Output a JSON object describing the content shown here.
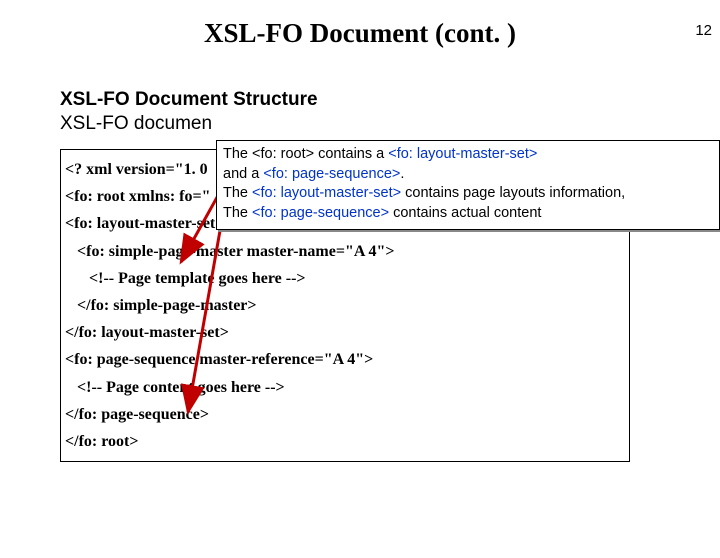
{
  "page_number": "12",
  "title": "XSL-FO Document (cont. )",
  "subhead": "XSL-FO Document Structure",
  "subline": "XSL-FO documen",
  "popup": {
    "l1a": "The <fo: root> contains a ",
    "l1b": "<fo: layout-master-set>",
    "l2a": "and a ",
    "l2b": "<fo: page-sequence>",
    "l2c": ".",
    "l3a": "The ",
    "l3b": "<fo: layout-master-set>",
    "l3c": " contains page layouts information,",
    "l4a": "The ",
    "l4b": "<fo: page-sequence>",
    "l4c": " contains actual content"
  },
  "code": {
    "c1": "<? xml version=\"1. 0",
    "c2": "<fo: root xmlns: fo=\"",
    "c3": "<fo: layout-master-set>",
    "c4": "<fo: simple-page-master master-name=\"A 4\">",
    "c5": "<!-- Page template goes here -->",
    "c6": "</fo: simple-page-master>",
    "c7": "</fo: layout-master-set>",
    "c8": "<fo: page-sequence master-reference=\"A 4\">",
    "c9": "<!-- Page content goes here -->",
    "c10": "</fo: page-sequence>",
    "c11": "</fo: root>"
  }
}
